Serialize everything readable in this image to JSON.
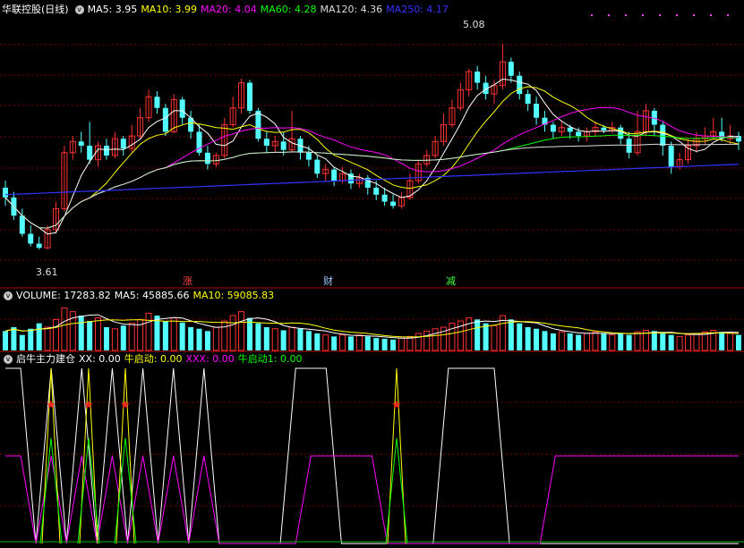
{
  "main": {
    "title": "华联控股(日线)",
    "ma_labels": [
      {
        "text": "MA5: 3.95",
        "color": "#ffffff"
      },
      {
        "text": "MA10: 3.99",
        "color": "#ffff00"
      },
      {
        "text": "MA20: 4.04",
        "color": "#ff00ff"
      },
      {
        "text": "MA60: 4.28",
        "color": "#00ff00"
      },
      {
        "text": "MA120: 4.36",
        "color": "#dddddd"
      },
      {
        "text": "MA250: 4.17",
        "color": "#3333ff"
      }
    ],
    "high_label": "5.08",
    "low_label": "3.61",
    "markers": [
      {
        "text": "涨",
        "color": "#ff4040"
      },
      {
        "text": "财",
        "color": "#9fc8ff"
      },
      {
        "text": "减",
        "color": "#40ff40"
      }
    ]
  },
  "volume": {
    "title": "VOLUME: 17283.82",
    "ma5": "MA5: 45885.66",
    "ma10": "MA10: 59085.83"
  },
  "indicator": {
    "title": "启牛主力建仓",
    "xx": "XX: 0.00",
    "niu": "牛启动: 0.00",
    "xxx": "XXX: 0.00",
    "niu1": "牛启动1: 0.00"
  },
  "chart_data": [
    {
      "type": "candlestick",
      "name": "华联控股(日线)",
      "ylim": [
        3.5,
        5.2
      ],
      "candles": [
        [
          4.05,
          3.98,
          4.1,
          3.92
        ],
        [
          3.98,
          3.85,
          4.02,
          3.82
        ],
        [
          3.85,
          3.72,
          3.9,
          3.7
        ],
        [
          3.72,
          3.65,
          3.78,
          3.63
        ],
        [
          3.65,
          3.62,
          3.7,
          3.61
        ],
        [
          3.62,
          3.75,
          3.78,
          3.61
        ],
        [
          3.75,
          3.9,
          3.95,
          3.72
        ],
        [
          3.9,
          4.3,
          4.35,
          3.88
        ],
        [
          4.3,
          4.38,
          4.42,
          4.25
        ],
        [
          4.38,
          4.35,
          4.45,
          4.3
        ],
        [
          4.35,
          4.25,
          4.52,
          4.22
        ],
        [
          4.25,
          4.35,
          4.38,
          4.2
        ],
        [
          4.35,
          4.28,
          4.4,
          4.25
        ],
        [
          4.28,
          4.4,
          4.45,
          4.26
        ],
        [
          4.4,
          4.33,
          4.42,
          4.28
        ],
        [
          4.33,
          4.42,
          4.5,
          4.3
        ],
        [
          4.42,
          4.55,
          4.62,
          4.4
        ],
        [
          4.55,
          4.7,
          4.75,
          4.52
        ],
        [
          4.7,
          4.62,
          4.74,
          4.58
        ],
        [
          4.62,
          4.45,
          4.65,
          4.42
        ],
        [
          4.45,
          4.68,
          4.72,
          4.44
        ],
        [
          4.68,
          4.55,
          4.7,
          4.5
        ],
        [
          4.55,
          4.45,
          4.6,
          4.4
        ],
        [
          4.45,
          4.3,
          4.5,
          4.28
        ],
        [
          4.3,
          4.22,
          4.35,
          4.18
        ],
        [
          4.22,
          4.28,
          4.3,
          4.2
        ],
        [
          4.28,
          4.5,
          4.55,
          4.26
        ],
        [
          4.5,
          4.62,
          4.7,
          4.48
        ],
        [
          4.62,
          4.8,
          4.83,
          4.58
        ],
        [
          4.8,
          4.6,
          4.82,
          4.58
        ],
        [
          4.6,
          4.4,
          4.62,
          4.38
        ],
        [
          4.4,
          4.35,
          4.45,
          4.3
        ],
        [
          4.35,
          4.38,
          4.42,
          4.3
        ],
        [
          4.38,
          4.32,
          4.45,
          4.28
        ],
        [
          4.32,
          4.4,
          4.6,
          4.3
        ],
        [
          4.4,
          4.3,
          4.42,
          4.25
        ],
        [
          4.3,
          4.25,
          4.35,
          4.2
        ],
        [
          4.25,
          4.15,
          4.28,
          4.12
        ],
        [
          4.15,
          4.18,
          4.22,
          4.1
        ],
        [
          4.18,
          4.1,
          4.2,
          4.06
        ],
        [
          4.1,
          4.15,
          4.2,
          4.08
        ],
        [
          4.15,
          4.08,
          4.18,
          4.04
        ],
        [
          4.08,
          4.12,
          4.15,
          4.05
        ],
        [
          4.12,
          4.05,
          4.14,
          4.0
        ],
        [
          4.05,
          4.0,
          4.1,
          3.96
        ],
        [
          4.0,
          3.95,
          4.05,
          3.92
        ],
        [
          3.95,
          3.92,
          4.0,
          3.9
        ],
        [
          3.92,
          3.98,
          4.02,
          3.9
        ],
        [
          3.98,
          4.1,
          4.15,
          3.96
        ],
        [
          4.1,
          4.22,
          4.25,
          4.08
        ],
        [
          4.22,
          4.28,
          4.32,
          4.2
        ],
        [
          4.28,
          4.38,
          4.42,
          4.26
        ],
        [
          4.38,
          4.5,
          4.58,
          4.35
        ],
        [
          4.5,
          4.62,
          4.68,
          4.48
        ],
        [
          4.62,
          4.75,
          4.8,
          4.6
        ],
        [
          4.75,
          4.88,
          4.9,
          4.7
        ],
        [
          4.88,
          4.8,
          4.92,
          4.75
        ],
        [
          4.8,
          4.72,
          4.85,
          4.68
        ],
        [
          4.72,
          4.78,
          4.82,
          4.65
        ],
        [
          4.78,
          4.95,
          5.08,
          4.75
        ],
        [
          4.95,
          4.85,
          4.98,
          4.8
        ],
        [
          4.85,
          4.72,
          4.88,
          4.68
        ],
        [
          4.72,
          4.65,
          4.75,
          4.6
        ],
        [
          4.65,
          4.55,
          4.7,
          4.5
        ],
        [
          4.55,
          4.5,
          4.6,
          4.45
        ],
        [
          4.5,
          4.45,
          4.52,
          4.4
        ],
        [
          4.45,
          4.48,
          4.52,
          4.42
        ],
        [
          4.48,
          4.45,
          4.5,
          4.4
        ],
        [
          4.45,
          4.42,
          4.48,
          4.38
        ],
        [
          4.42,
          4.45,
          4.48,
          4.38
        ],
        [
          4.45,
          4.48,
          4.52,
          4.42
        ],
        [
          4.48,
          4.46,
          4.5,
          4.44
        ],
        [
          4.46,
          4.48,
          4.52,
          4.44
        ],
        [
          4.48,
          4.4,
          4.5,
          4.36
        ],
        [
          4.4,
          4.3,
          4.45,
          4.26
        ],
        [
          4.3,
          4.45,
          4.6,
          4.28
        ],
        [
          4.45,
          4.6,
          4.65,
          4.42
        ],
        [
          4.6,
          4.5,
          4.62,
          4.42
        ],
        [
          4.5,
          4.35,
          4.52,
          4.28
        ],
        [
          4.35,
          4.2,
          4.38,
          4.15
        ],
        [
          4.2,
          4.25,
          4.3,
          4.18
        ],
        [
          4.25,
          4.35,
          4.4,
          4.22
        ],
        [
          4.35,
          4.4,
          4.45,
          4.3
        ],
        [
          4.4,
          4.42,
          4.48,
          4.36
        ],
        [
          4.42,
          4.45,
          4.55,
          4.4
        ],
        [
          4.45,
          4.4,
          4.55,
          4.38
        ],
        [
          4.4,
          4.42,
          4.5,
          4.36
        ],
        [
          4.42,
          4.38,
          4.45,
          4.32
        ]
      ]
    },
    {
      "type": "bar",
      "name": "VOLUME",
      "values": [
        25,
        30,
        20,
        28,
        35,
        30,
        40,
        55,
        50,
        45,
        38,
        42,
        30,
        28,
        32,
        35,
        40,
        48,
        45,
        38,
        42,
        36,
        30,
        28,
        25,
        30,
        38,
        45,
        50,
        42,
        35,
        30,
        28,
        26,
        30,
        28,
        25,
        22,
        20,
        18,
        20,
        18,
        20,
        18,
        16,
        15,
        14,
        16,
        18,
        22,
        25,
        28,
        30,
        35,
        38,
        42,
        40,
        35,
        32,
        45,
        40,
        35,
        30,
        28,
        25,
        22,
        24,
        22,
        20,
        22,
        24,
        22,
        20,
        22,
        20,
        24,
        26,
        25,
        22,
        20,
        18,
        20,
        22,
        24,
        26,
        24,
        22,
        20
      ]
    },
    {
      "type": "line",
      "name": "启牛主力建仓",
      "series": [
        {
          "name": "XX",
          "values": [
            1,
            1,
            0,
            1,
            0,
            1,
            0,
            1,
            0,
            1,
            0,
            1,
            0,
            1,
            0,
            0,
            0,
            0,
            0,
            1,
            1,
            1,
            0,
            0,
            0,
            0,
            0,
            0,
            0,
            1,
            1,
            1,
            1,
            0,
            0,
            0,
            0,
            0,
            0,
            0,
            0,
            0,
            0,
            0,
            0,
            0,
            0,
            0,
            0
          ]
        },
        {
          "name": "XXX",
          "values": [
            1,
            1,
            0,
            1,
            0,
            1,
            0,
            1,
            0,
            1,
            0,
            1,
            0,
            1,
            0,
            0,
            0,
            0,
            0,
            0,
            1,
            1,
            1,
            1,
            1,
            0,
            0,
            0,
            0,
            0,
            0,
            0,
            0,
            0,
            0,
            0,
            1,
            1,
            1,
            1,
            1,
            1,
            1,
            1,
            1,
            1,
            1,
            1,
            1
          ]
        }
      ],
      "signals": [
        "★",
        "★",
        "★",
        "★"
      ]
    }
  ]
}
